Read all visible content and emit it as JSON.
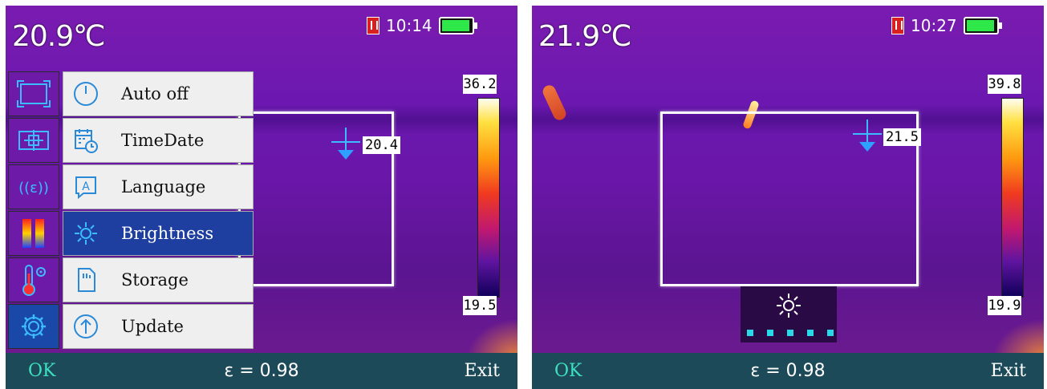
{
  "colors": {
    "accent_ok": "#3de0c0",
    "menu_active": "#1f3fa0",
    "bottom_bar": "#1d4a58",
    "battery": "#2ee84a",
    "crosshair": "#3bbcff"
  },
  "left": {
    "temp": "20.9℃",
    "time": "10:14",
    "scale_max": "36.2",
    "scale_min": "19.5",
    "point_value": "20.4",
    "sidebar_icons": [
      "area-measure-icon",
      "center-point-icon",
      "emissivity-icon",
      "palette-icon",
      "temperature-settings-icon",
      "gear-icon"
    ],
    "menu": [
      {
        "label": "Auto off",
        "icon": "power-icon"
      },
      {
        "label": "TimeDate",
        "icon": "calendar-clock-icon"
      },
      {
        "label": "Language",
        "icon": "language-icon"
      },
      {
        "label": "Brightness",
        "icon": "sun-icon",
        "active": true
      },
      {
        "label": "Storage",
        "icon": "sd-card-icon"
      },
      {
        "label": "Update",
        "icon": "update-arrow-icon"
      }
    ],
    "bottom": {
      "ok": "OK",
      "emissivity": "ε = 0.98",
      "exit": "Exit"
    }
  },
  "right": {
    "temp": "21.9℃",
    "time": "10:27",
    "scale_max": "39.8",
    "scale_min": "19.9",
    "point_value": "21.5",
    "brightness_level": 5,
    "brightness_max": 5,
    "bottom": {
      "ok": "OK",
      "emissivity": "ε = 0.98",
      "exit": "Exit"
    }
  }
}
